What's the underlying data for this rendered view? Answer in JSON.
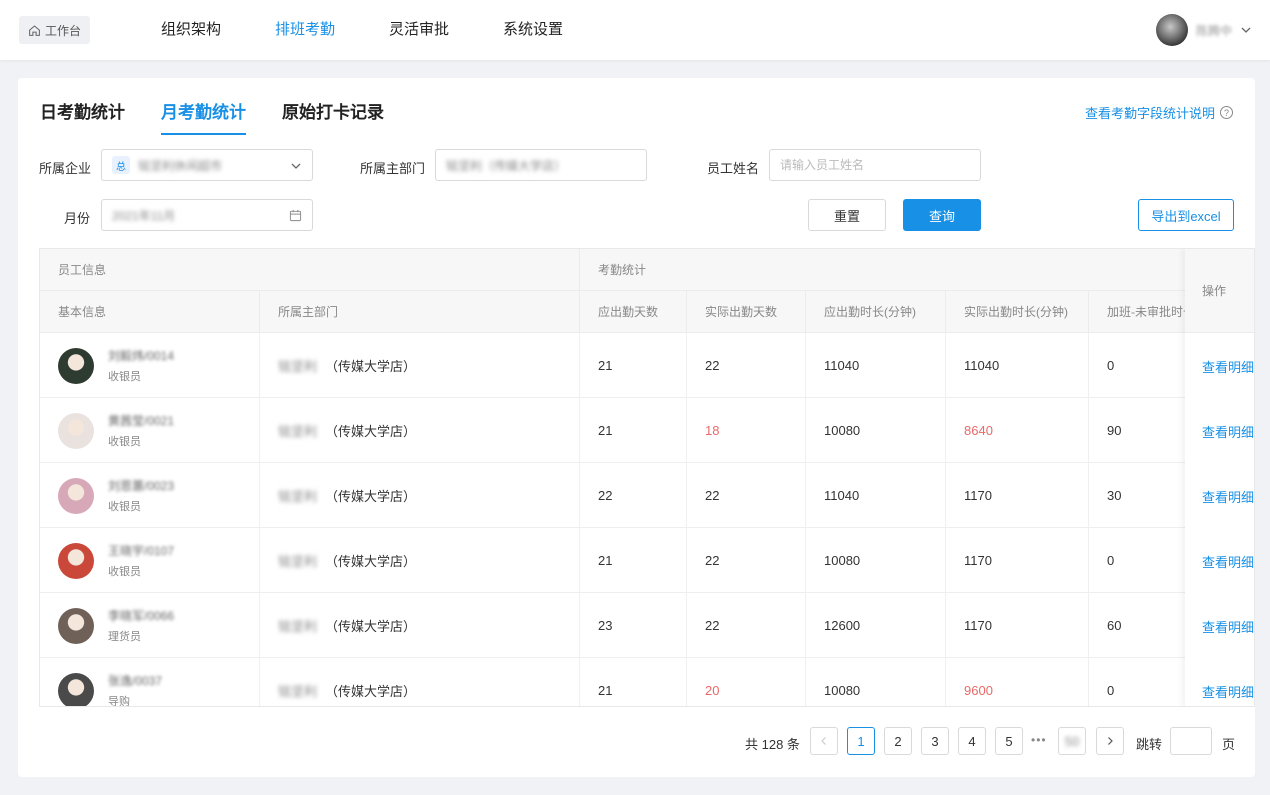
{
  "topbar": {
    "home_label": "工作台",
    "nav": [
      "组织架构",
      "排班考勤",
      "灵活审批",
      "系统设置"
    ],
    "active_nav": 1,
    "user_name": "陈腾中"
  },
  "tabs": [
    "日考勤统计",
    "月考勤统计",
    "原始打卡记录"
  ],
  "active_tab": 1,
  "help_link": "查看考勤字段统计说明",
  "filters": {
    "company_label": "所属企业",
    "company_badge": "总",
    "company_value": "铭坚利休闲超市",
    "dept_label": "所属主部门",
    "dept_value": "铭坚利（传媒大学店）",
    "name_label": "员工姓名",
    "name_placeholder": "请输入员工姓名",
    "month_label": "月份",
    "month_value": "2021年11月",
    "reset": "重置",
    "query": "查询",
    "export": "导出到excel"
  },
  "table": {
    "group_headers": [
      "员工信息",
      "考勤统计"
    ],
    "headers": [
      "基本信息",
      "所属主部门",
      "应出勤天数",
      "实际出勤天数",
      "应出勤时长(分钟)",
      "实际出勤时长(分钟)",
      "加班-未审批时长"
    ],
    "op_header": "操作",
    "op_link": "查看明细",
    "dept_blur": "铭坚利",
    "dept_suffix": "（传媒大学店）",
    "rows": [
      {
        "name": "刘毅炜/0014",
        "role": "收银员",
        "days_due": "21",
        "days_actual": "22",
        "min_due": "11040",
        "min_actual": "11040",
        "overtime": "0",
        "avatar_color": "#2e3b30",
        "red_days": false,
        "red_min": false
      },
      {
        "name": "黄茜莹/0021",
        "role": "收银员",
        "days_due": "21",
        "days_actual": "18",
        "min_due": "10080",
        "min_actual": "8640",
        "overtime": "90",
        "avatar_color": "#e9e2de",
        "red_days": true,
        "red_min": true
      },
      {
        "name": "刘恩蕙/0023",
        "role": "收银员",
        "days_due": "22",
        "days_actual": "22",
        "min_due": "11040",
        "min_actual": "1170",
        "overtime": "30",
        "avatar_color": "#d7a9b8",
        "red_days": false,
        "red_min": false
      },
      {
        "name": "王晓宇/0107",
        "role": "收银员",
        "days_due": "21",
        "days_actual": "22",
        "min_due": "10080",
        "min_actual": "1170",
        "overtime": "0",
        "avatar_color": "#c9483a",
        "red_days": false,
        "red_min": false
      },
      {
        "name": "李晓军/0066",
        "role": "理货员",
        "days_due": "23",
        "days_actual": "22",
        "min_due": "12600",
        "min_actual": "1170",
        "overtime": "60",
        "avatar_color": "#6f6158",
        "red_days": false,
        "red_min": false
      },
      {
        "name": "张逸/0037",
        "role": "导购",
        "days_due": "21",
        "days_actual": "20",
        "min_due": "10080",
        "min_actual": "9600",
        "overtime": "0",
        "avatar_color": "#4a4a4a",
        "red_days": true,
        "red_min": true
      }
    ]
  },
  "pager": {
    "total": "共 128 条",
    "pages": [
      "1",
      "2",
      "3",
      "4",
      "5"
    ],
    "last_page": "50",
    "jump_label": "跳转",
    "page_unit": "页"
  },
  "colors": {
    "accent": "#1890e6",
    "warn": "#e86a6a"
  }
}
